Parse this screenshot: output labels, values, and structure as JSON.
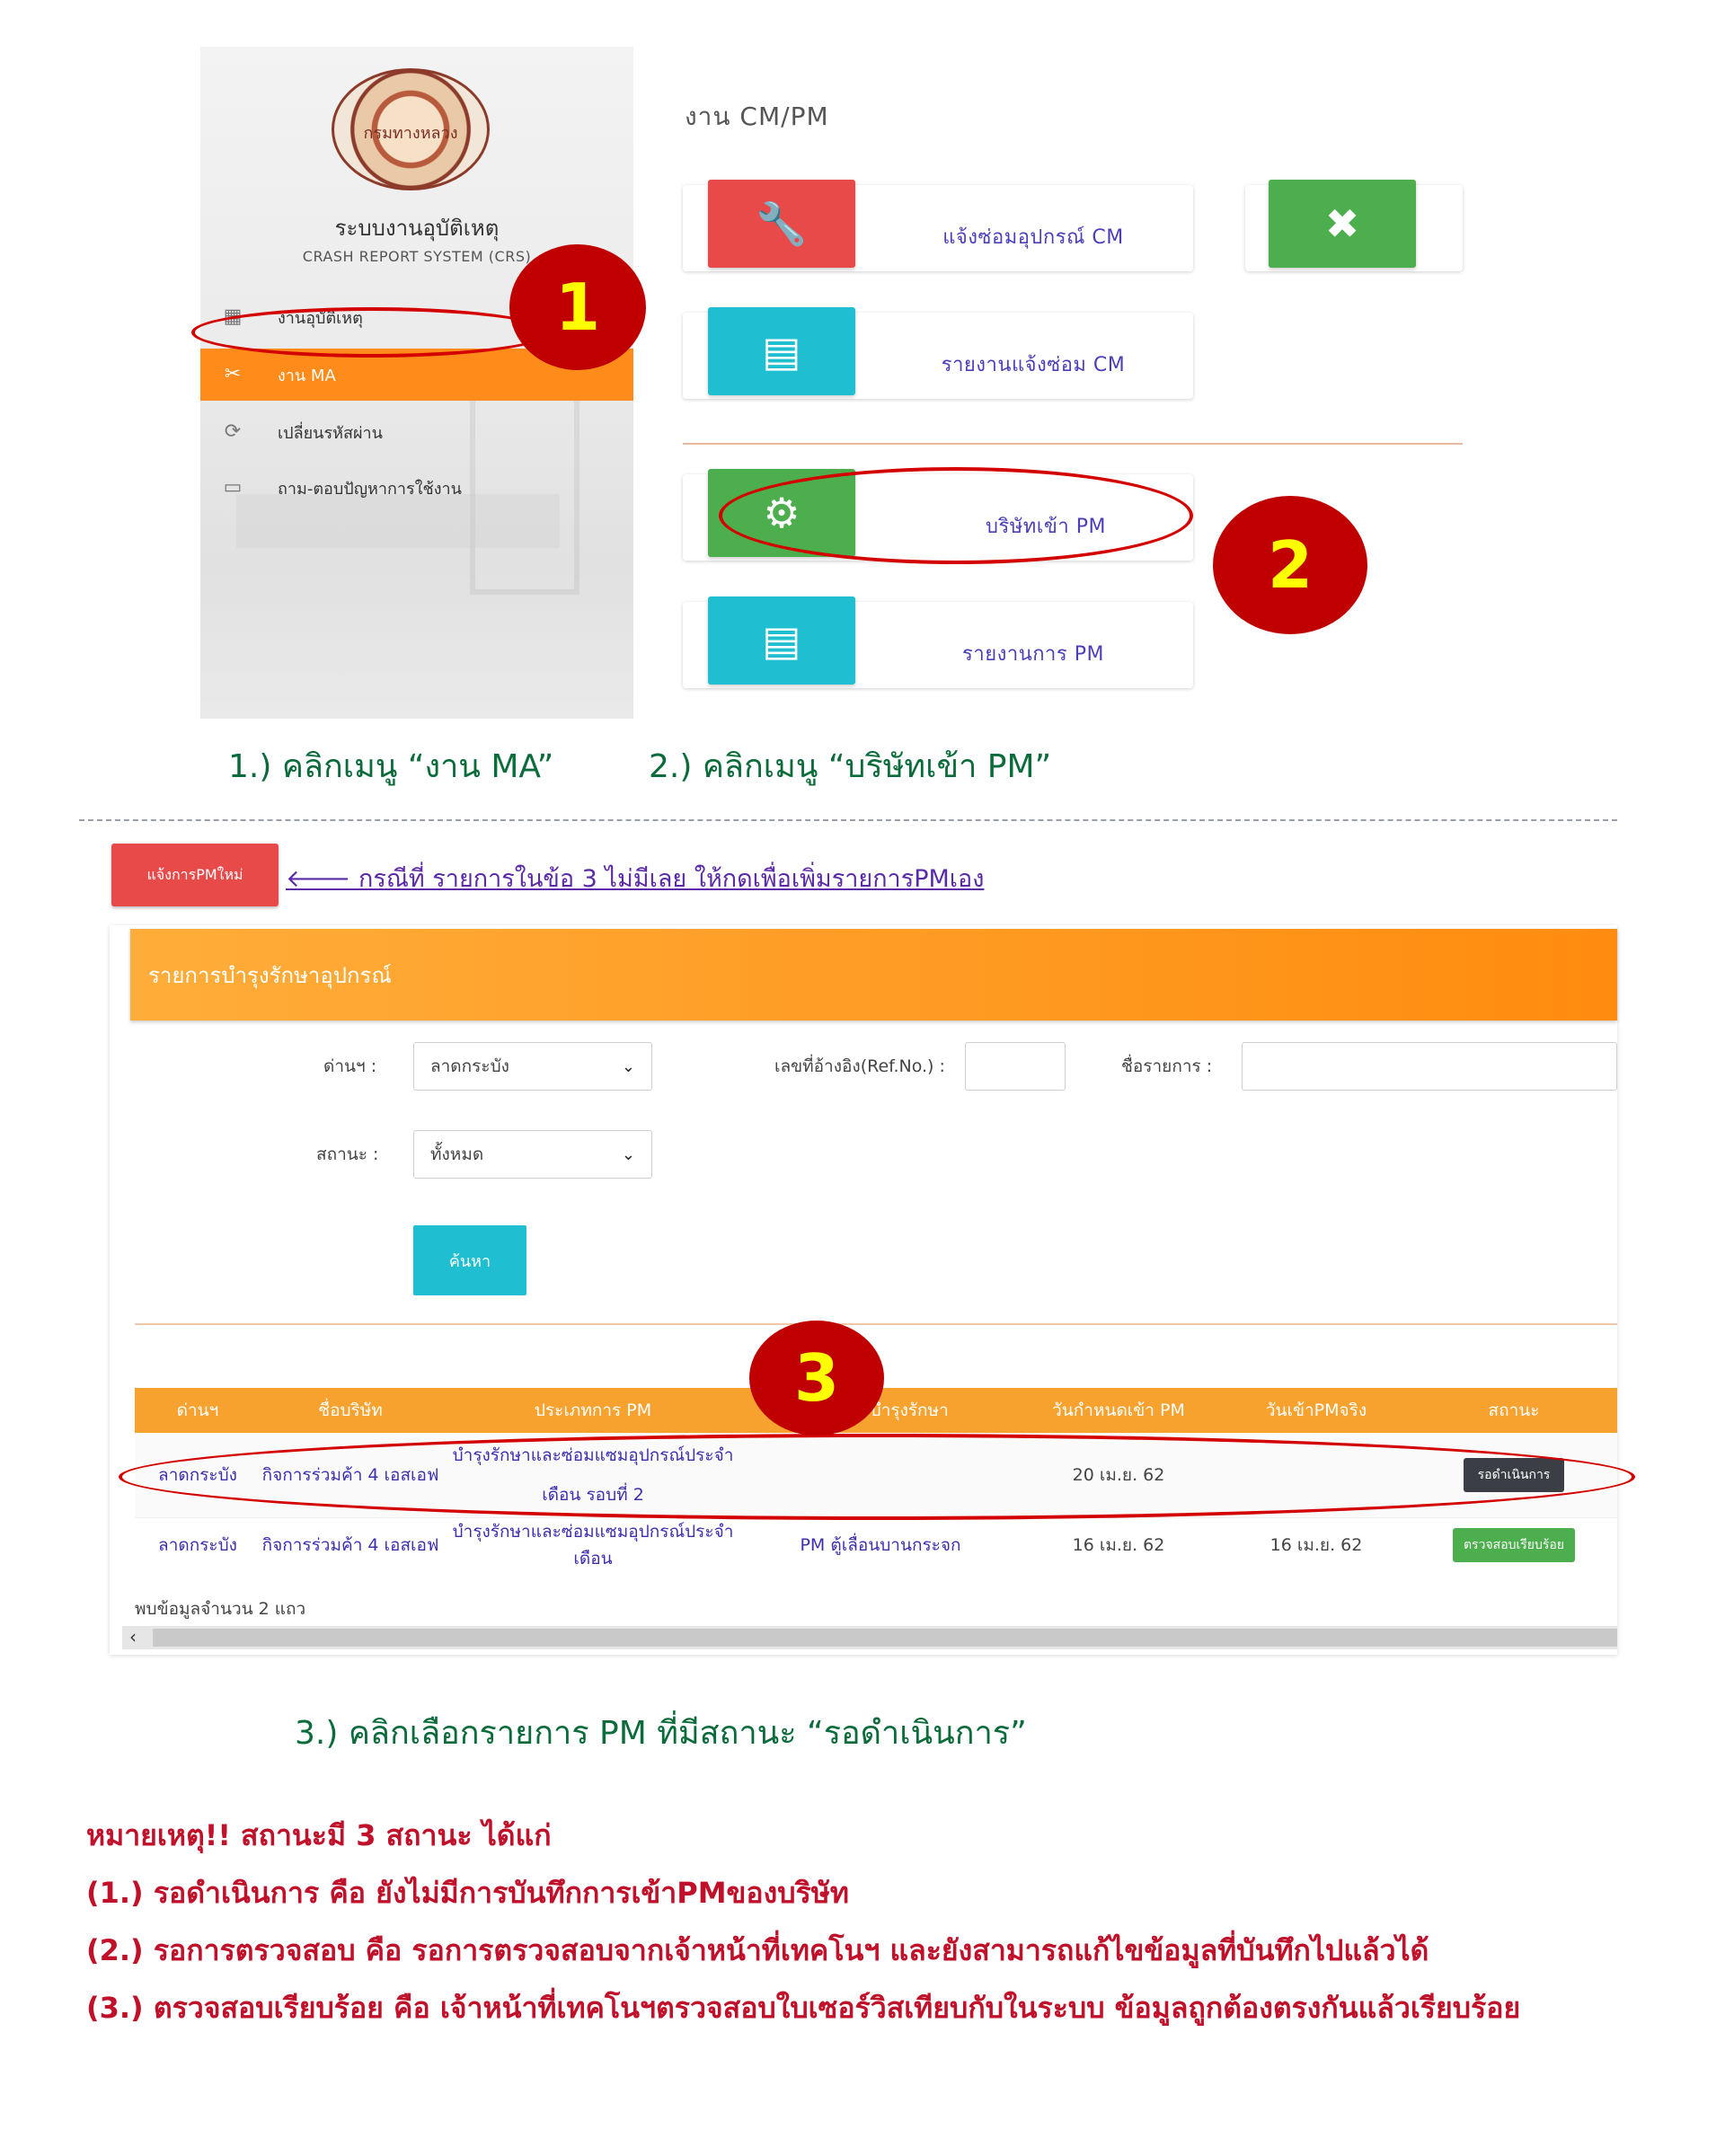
{
  "sidebar": {
    "logo_text": "กรมทางหลวง",
    "title": "ระบบงานอุบัติเหตุ",
    "subtitle": "CRASH REPORT SYSTEM (CRS)",
    "items": [
      {
        "label": "งานอุบัติเหตุ",
        "icon": "table-icon"
      },
      {
        "label": "งาน MA",
        "icon": "wrench-screwdriver-icon"
      },
      {
        "label": "เปลี่ยนรหัสผ่าน",
        "icon": "refresh-icon"
      },
      {
        "label": "ถาม-ตอบปัญหาการใช้งาน",
        "icon": "chat-icon"
      }
    ]
  },
  "cmpm": {
    "title": "งาน CM/PM",
    "cards": [
      {
        "label": "แจ้งซ่อมอุปกรณ์ CM",
        "icon": "wrench-icon",
        "color": "#e84a4a"
      },
      {
        "label": "",
        "icon": "tools-icon",
        "color": "#4cae4c"
      },
      {
        "label": "รายงานแจ้งซ่อม CM",
        "icon": "document-icon",
        "color": "#1fbfd1"
      },
      {
        "label": "บริษัทเข้า PM",
        "icon": "gears-icon",
        "color": "#4cae4c"
      },
      {
        "label": "รายงานการ PM",
        "icon": "document-icon",
        "color": "#1fbfd1"
      }
    ]
  },
  "annotations": {
    "badge1": "1",
    "badge2": "2",
    "badge3": "3",
    "caption1": "1.) คลิกเมนู “งาน MA”",
    "caption2": "2.)  คลิกเมนู “บริษัทเข้า PM”",
    "caption3": "3.) คลิกเลือกรายการ PM ที่มีสถานะ “รอดำเนินการ”"
  },
  "new_pm": {
    "button_label": "แจ้งการPMใหม่",
    "note": "กรณีที่ รายการในข้อ 3 ไม่มีเลย ให้กดเพื่อเพิ่มรายการPMเอง"
  },
  "panel": {
    "title": "รายการบำรุงรักษาอุปกรณ์",
    "filters": {
      "station_label": "ด่านฯ :",
      "station_value": "ลาดกระบัง",
      "ref_label": "เลขที่อ้างอิง(Ref.No.) :",
      "ref_value": "",
      "name_label": "ชื่อรายการ :",
      "name_value": "",
      "status_label": "สถานะ :",
      "status_value": "ทั้งหมด",
      "search_button": "ค้นหา"
    },
    "table": {
      "headers": [
        "ด่านฯ",
        "ชื่อบริษัท",
        "ประเภทการ PM",
        "รายการบำรุงรักษา",
        "วันกำหนดเข้า PM",
        "วันเข้าPMจริง",
        "สถานะ"
      ],
      "rows": [
        {
          "station": "ลาดกระบัง",
          "company": "กิจการร่วมค้า 4 เอสเอฟ",
          "type": "บำรุงรักษาและซ่อมแซมอุปกรณ์ประจำเดือน รอบที่ 2",
          "item": "",
          "due": "20 เม.ย. 62",
          "actual": "",
          "status": "รอดำเนินการ"
        },
        {
          "station": "ลาดกระบัง",
          "company": "กิจการร่วมค้า 4 เอสเอฟ",
          "type": "บำรุงรักษาและซ่อมแซมอุปกรณ์ประจำเดือน",
          "item": "PM ตู้เลื่อนบานกระจก",
          "due": "16 เม.ย. 62",
          "actual": "16 เม.ย. 62",
          "status": "ตรวจสอบเรียบร้อย"
        }
      ]
    },
    "found_text": "พบข้อมูลจำนวน 2 แถว"
  },
  "notes": {
    "heading": "หมายเหตุ!!  สถานะมี 3 สถานะ  ได้แก่",
    "items": [
      "(1.) รอดำเนินการ  คือ ยังไม่มีการบันทึกการเข้าPMของบริษัท",
      "(2.) รอการตรวจสอบ คือ รอการตรวจสอบจากเจ้าหน้าที่เทคโนฯ และยังสามารถแก้ไขข้อมูลที่บันทึกไปแล้วได้",
      "(3.) ตรวจสอบเรียบร้อย คือ เจ้าหน้าที่เทคโนฯตรวจสอบใบเซอร์วิสเทียบกับในระบบ ข้อมูลถูกต้องตรงกันแล้วเรียบร้อย"
    ]
  }
}
